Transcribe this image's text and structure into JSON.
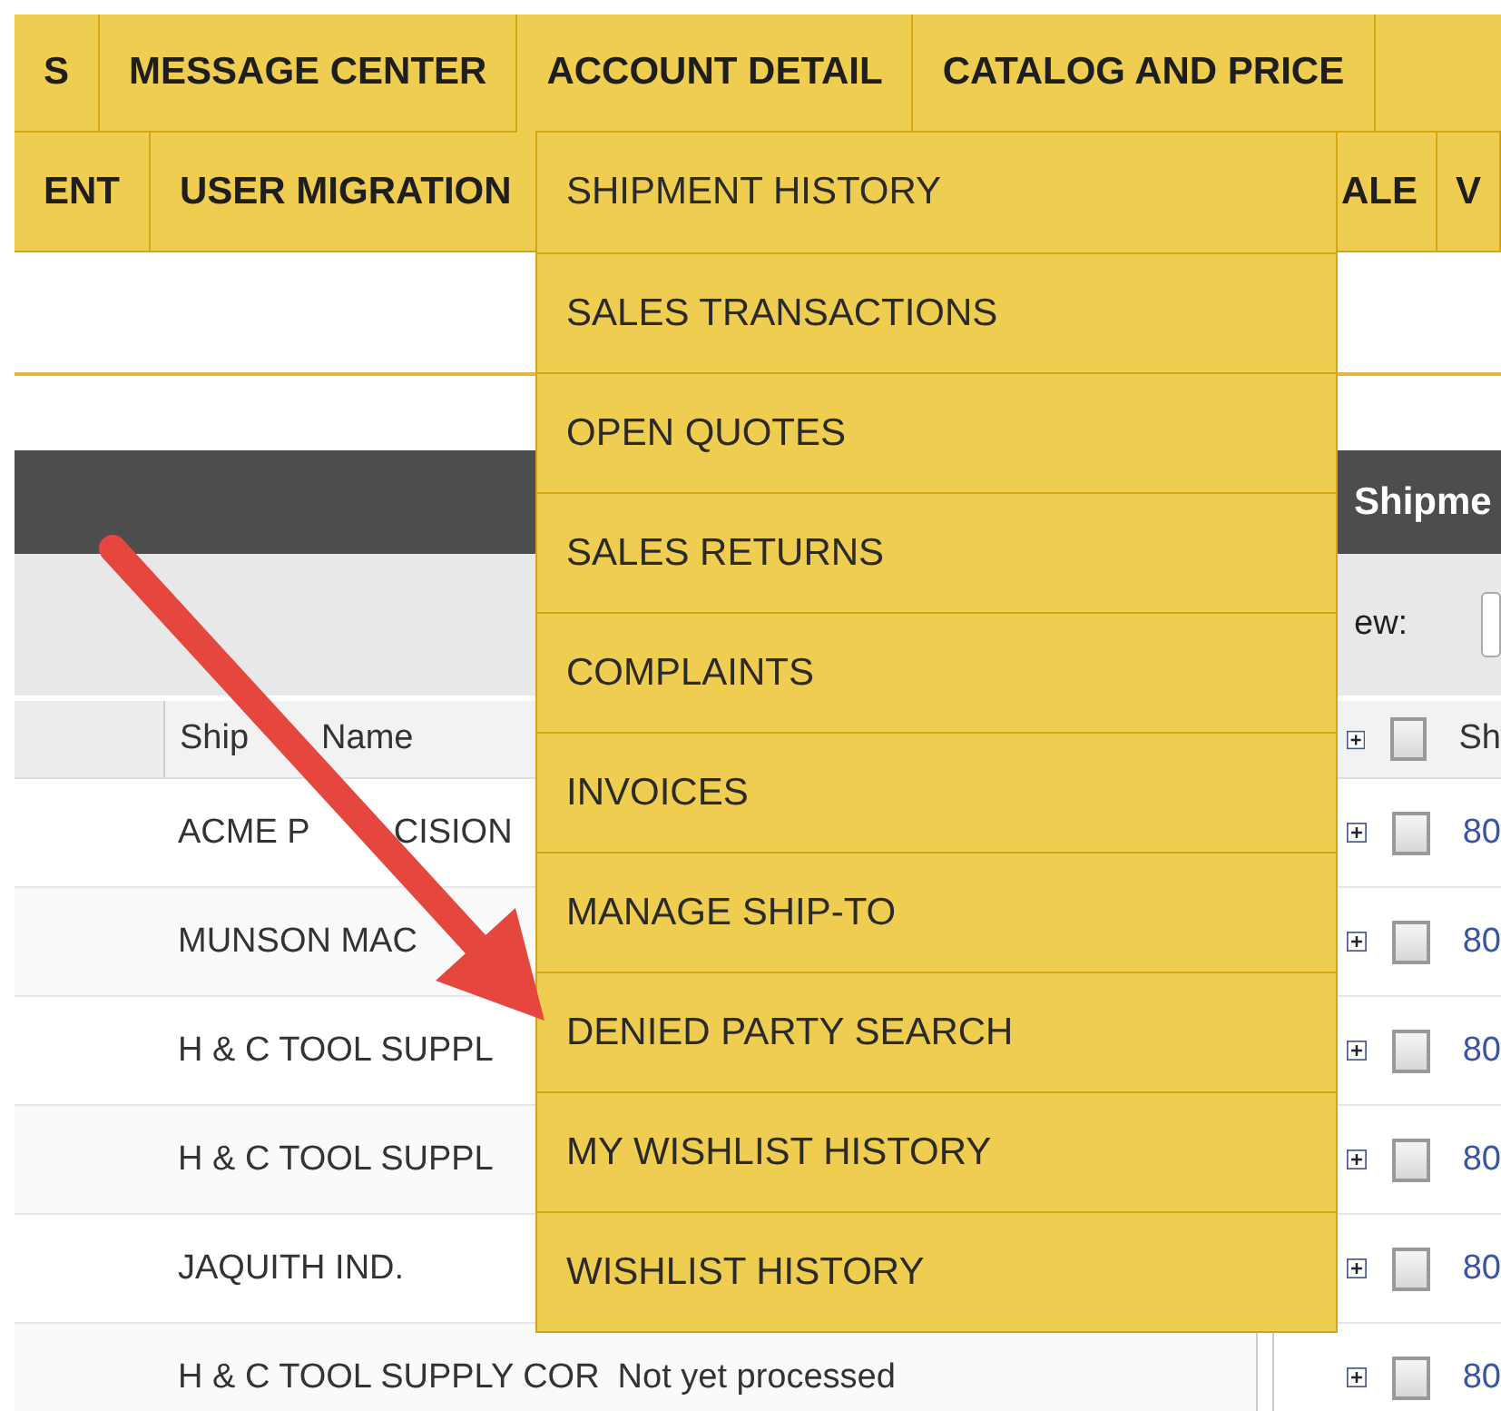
{
  "nav_row_1": [
    {
      "label": "S",
      "selected": false
    },
    {
      "label": "MESSAGE CENTER",
      "selected": false
    },
    {
      "label": "ACCOUNT DETAIL",
      "selected": true
    },
    {
      "label": "CATALOG AND PRICE",
      "selected": false
    }
  ],
  "nav_row_2": {
    "items_left": [
      {
        "label": "ENT"
      },
      {
        "label": "USER MIGRATION"
      }
    ],
    "items_right": [
      {
        "label": "ALE"
      },
      {
        "label": "V"
      }
    ]
  },
  "dropdown": {
    "items": [
      {
        "label": "SHIPMENT HISTORY"
      },
      {
        "label": "SALES TRANSACTIONS"
      },
      {
        "label": "OPEN QUOTES"
      },
      {
        "label": "SALES RETURNS"
      },
      {
        "label": "COMPLAINTS"
      },
      {
        "label": "INVOICES"
      },
      {
        "label": "MANAGE SHIP-TO"
      },
      {
        "label": "DENIED PARTY SEARCH"
      },
      {
        "label": "MY WISHLIST HISTORY"
      },
      {
        "label": "WISHLIST HISTORY"
      }
    ]
  },
  "left_table": {
    "columns": [
      [
        "Ship",
        "Name"
      ]
    ],
    "rows": [
      {
        "ship_to_name": [
          "ACME P",
          "CISION"
        ]
      },
      {
        "ship_to_name": "MUNSON MAC"
      },
      {
        "ship_to_name": "H & C TOOL SUPPL"
      },
      {
        "ship_to_name": "H & C TOOL SUPPL"
      },
      {
        "ship_to_name": "JAQUITH IND."
      },
      {
        "ship_to_name": "H & C TOOL SUPPLY COR",
        "column_3": "Not yet processed"
      }
    ]
  },
  "right_panel": {
    "title": "Shipme",
    "view_label": "ew:",
    "header": {
      "checked": false,
      "column": "Sh"
    },
    "rows": [
      {
        "checked": false,
        "value": "80"
      },
      {
        "checked": false,
        "value": "80"
      },
      {
        "checked": false,
        "value": "80"
      },
      {
        "checked": false,
        "value": "80"
      },
      {
        "checked": false,
        "value": "80"
      },
      {
        "checked": false,
        "value": "80"
      }
    ]
  }
}
